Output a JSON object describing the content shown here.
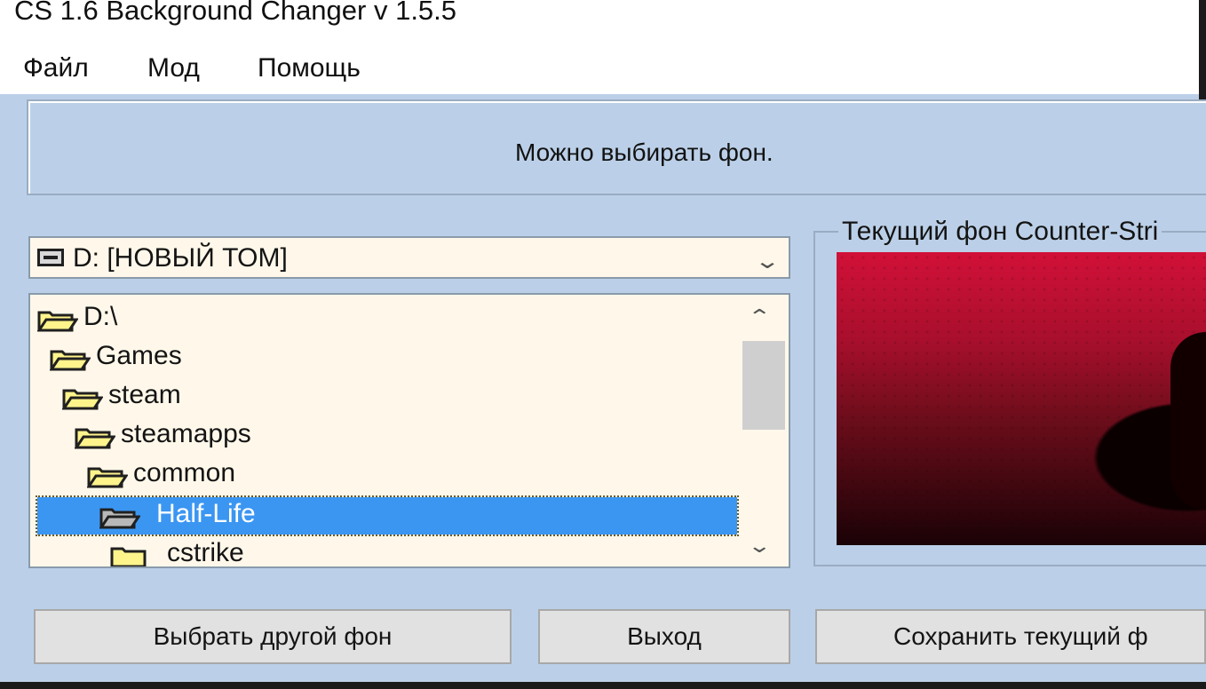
{
  "window": {
    "title": "CS 1.6 Background Changer v 1.5.5"
  },
  "menu": {
    "items": [
      "Файл",
      "Мод",
      "Помощь"
    ]
  },
  "status": {
    "text": "Можно выбирать фон."
  },
  "drive_select": {
    "value": "D: [НОВЫЙ ТОМ]",
    "icon": "hard-drive-icon"
  },
  "folder_tree": {
    "items": [
      {
        "label": "D:\\",
        "icon": "open-folder-icon",
        "depth": 0,
        "selected": false
      },
      {
        "label": "Games",
        "icon": "open-folder-icon",
        "depth": 1,
        "selected": false
      },
      {
        "label": "steam",
        "icon": "open-folder-icon",
        "depth": 2,
        "selected": false
      },
      {
        "label": "steamapps",
        "icon": "open-folder-icon",
        "depth": 3,
        "selected": false
      },
      {
        "label": "common",
        "icon": "open-folder-icon",
        "depth": 4,
        "selected": false
      },
      {
        "label": "Half-Life",
        "icon": "open-folder-icon",
        "depth": 5,
        "selected": true
      },
      {
        "label": "cstrike",
        "icon": "closed-folder-icon",
        "depth": 6,
        "selected": false
      }
    ]
  },
  "preview": {
    "legend": "Текущий фон Counter-Stri"
  },
  "buttons": {
    "choose": "Выбрать другой фон",
    "exit": "Выход",
    "save": "Сохранить текущий ф"
  },
  "colors": {
    "window_bg": "#bbd0e8",
    "list_bg": "#fff8ea",
    "selection": "#3b96f2",
    "folder_yellow": "#fff48c"
  }
}
